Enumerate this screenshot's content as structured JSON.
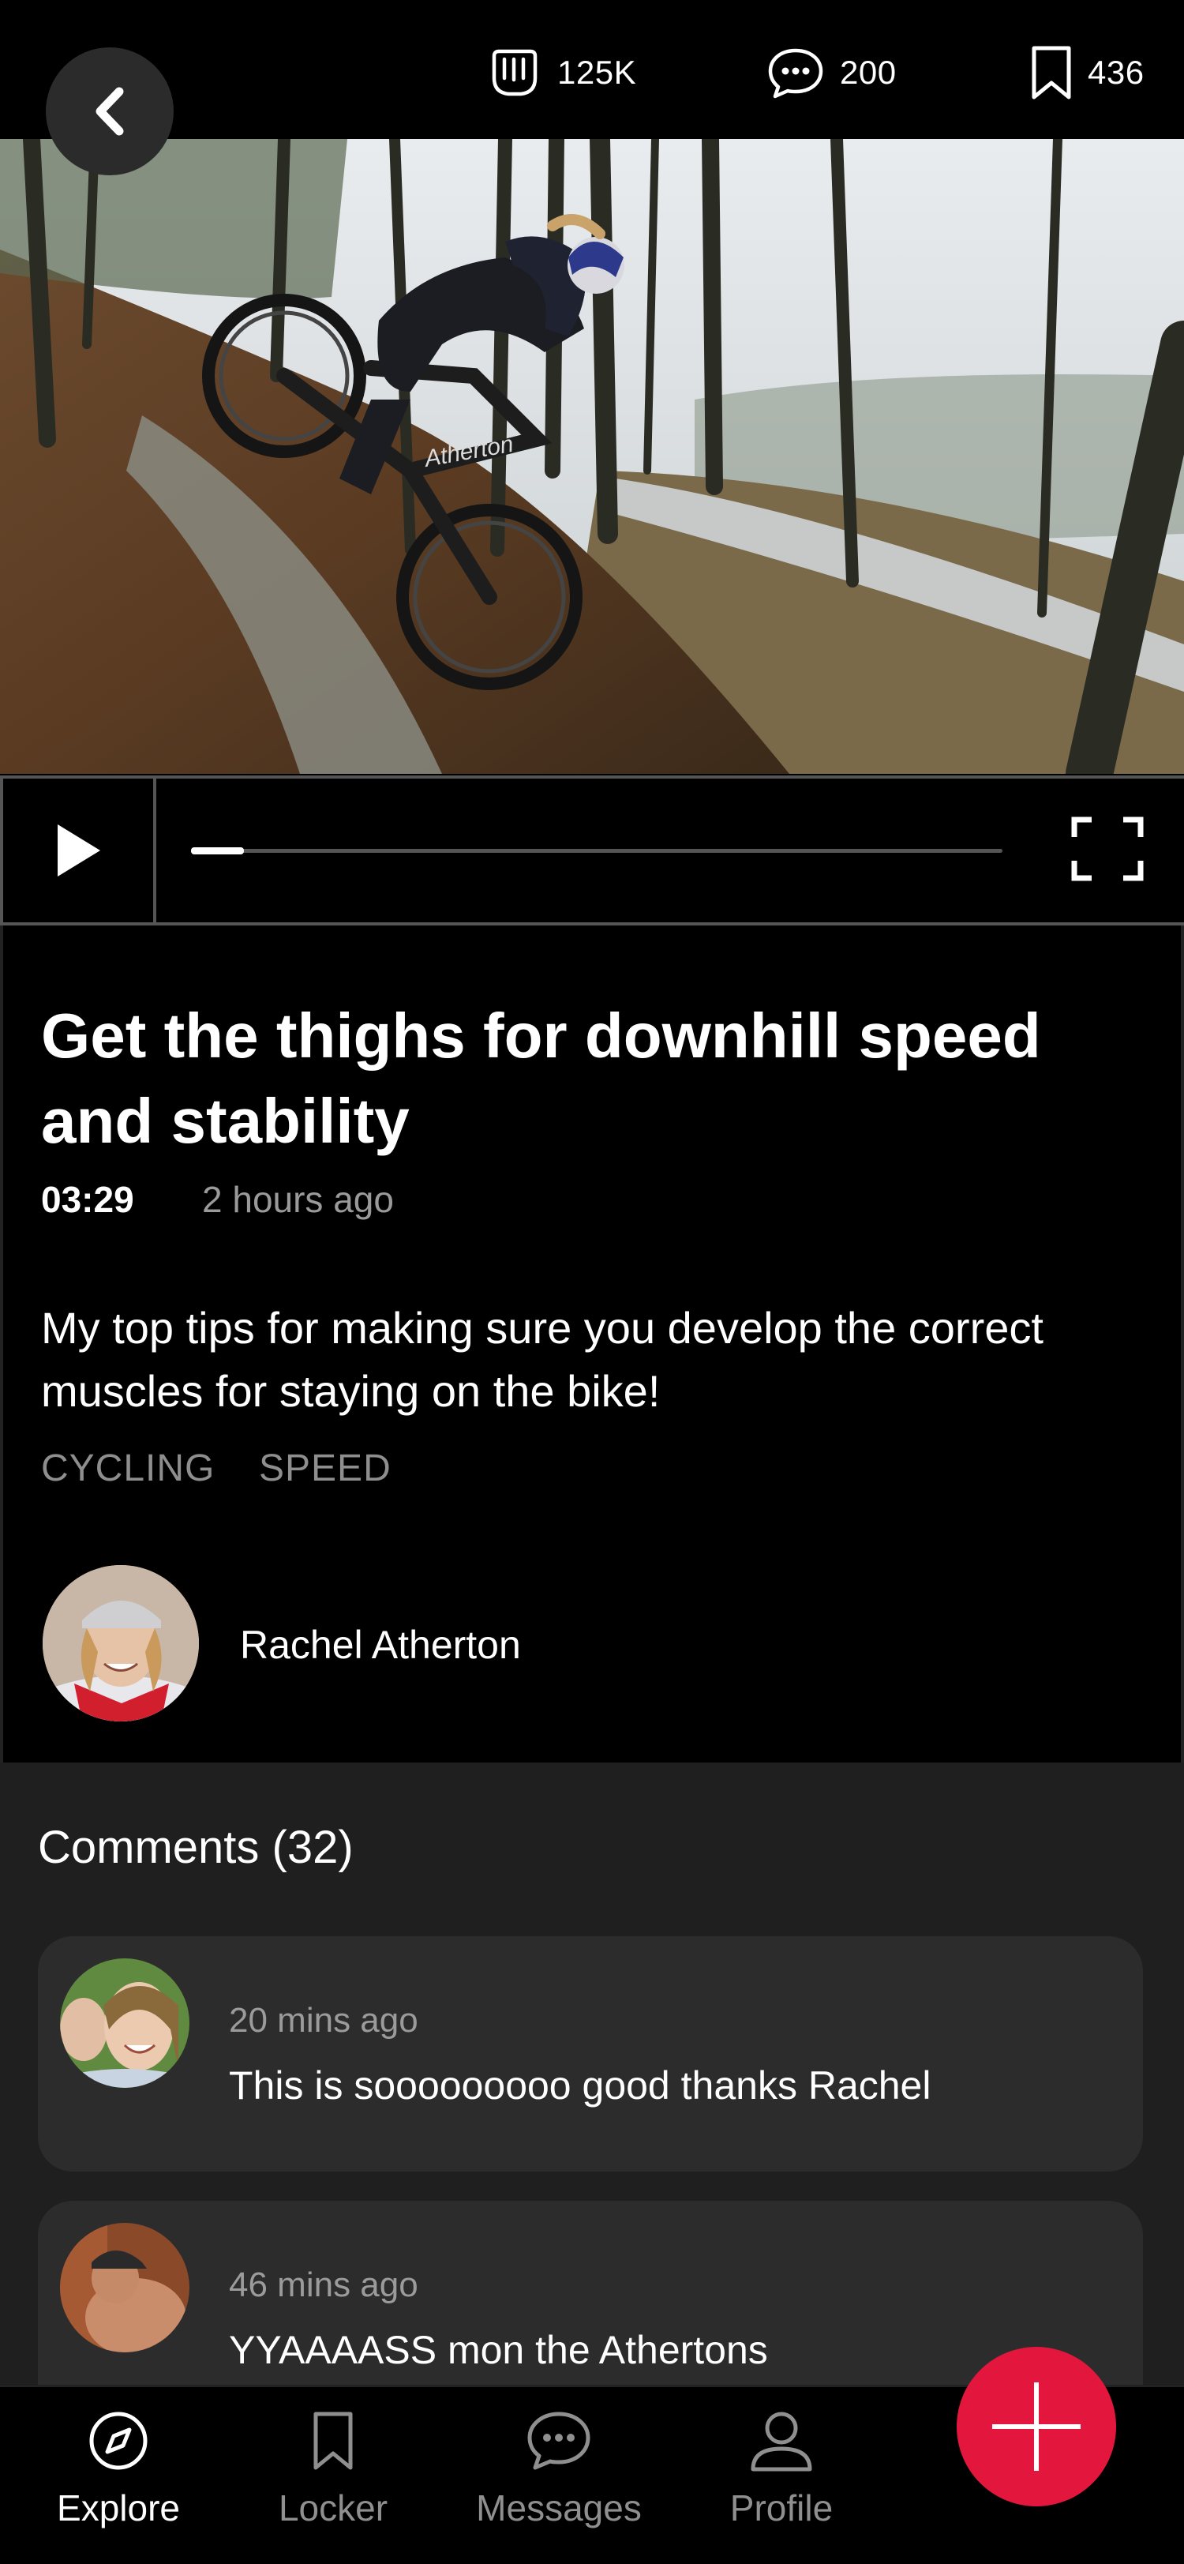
{
  "header": {
    "stats": [
      {
        "icon": "fist-bump-icon",
        "value": "125K"
      },
      {
        "icon": "comment-bubble-icon",
        "value": "200"
      },
      {
        "icon": "bookmark-icon",
        "value": "436"
      }
    ]
  },
  "player": {
    "progress_percent": 6.5
  },
  "video": {
    "title": "Get the thighs for downhill speed and stability",
    "duration": "03:29",
    "posted": "2 hours ago",
    "description": "My top tips for making sure you develop the correct muscles for staying on the bike!",
    "tags": [
      "CYCLING",
      "SPEED"
    ],
    "author": {
      "name": "Rachel Atherton"
    }
  },
  "comments": {
    "heading": "Comments (32)",
    "items": [
      {
        "time": "20 mins ago",
        "text": "This is sooooooooo good thanks Rachel"
      },
      {
        "time": "46 mins ago",
        "text": "YYAAAASS mon the Athertons"
      }
    ]
  },
  "nav": {
    "items": [
      {
        "label": "Explore",
        "icon": "compass-icon",
        "active": true
      },
      {
        "label": "Locker",
        "icon": "bookmark-icon",
        "active": false
      },
      {
        "label": "Messages",
        "icon": "chat-icon",
        "active": false
      },
      {
        "label": "Profile",
        "icon": "person-icon",
        "active": false
      }
    ]
  },
  "colors": {
    "accent": "#e3173e",
    "background": "#000000",
    "comments_bg": "#1f1f1f",
    "card_bg": "#2c2c2c"
  }
}
